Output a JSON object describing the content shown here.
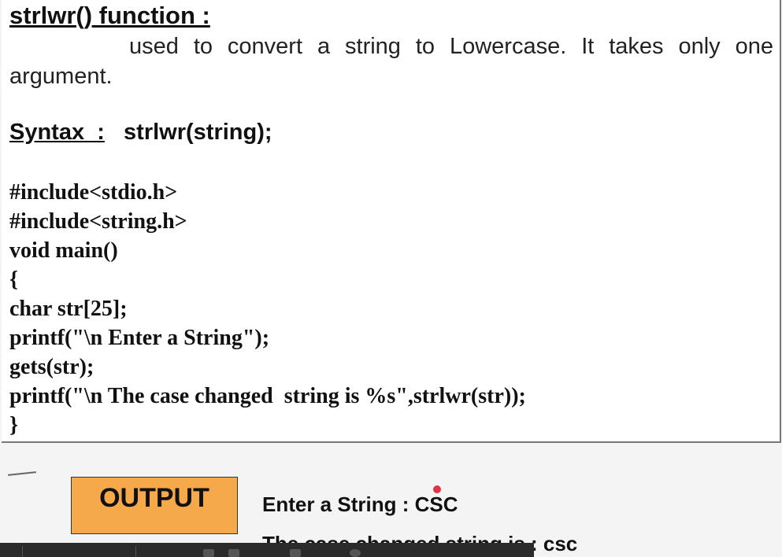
{
  "slide": {
    "heading": "strlwr() function :",
    "description": "used to convert a string to Lowercase. It takes only one argument.",
    "syntax_label": "Syntax  :",
    "syntax_value": "strlwr(string);",
    "code_lines": [
      "#include<stdio.h>",
      "#include<string.h>",
      "void main()",
      "{",
      "char str[25];",
      "printf(\"\\n Enter a String\");",
      "gets(str);",
      "printf(\"\\n The case changed  string is %s\",strlwr(str));",
      "}"
    ]
  },
  "output": {
    "label": "OUTPUT",
    "line1": "Enter a String : CSC",
    "line2": "The case changed string is : csc"
  },
  "colors": {
    "output_box": "#f6a94b",
    "pointer": "#e0334a"
  }
}
